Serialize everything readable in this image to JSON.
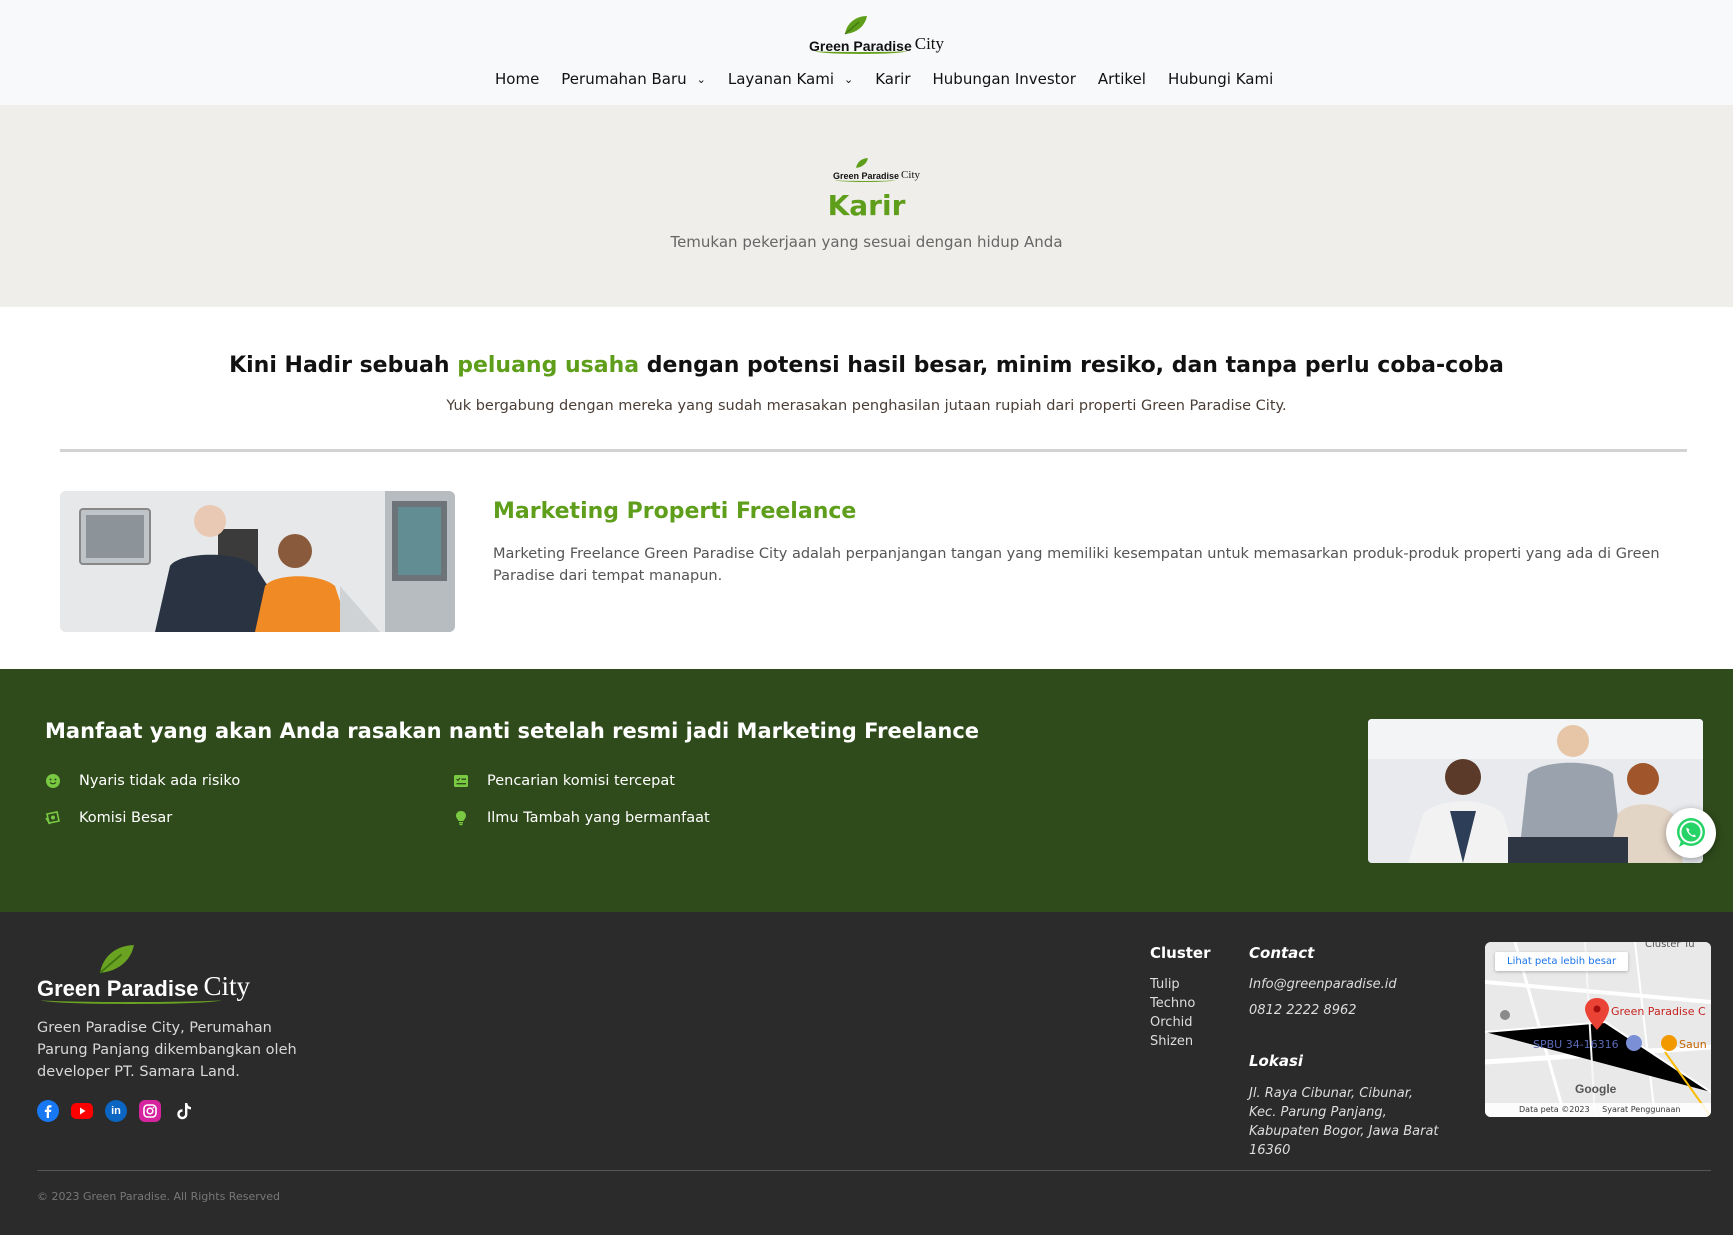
{
  "brand": {
    "name_word1": "Green Paradise",
    "name_word2": "City",
    "accent_color": "#5e9e1a",
    "dark_green": "#2f4a1b"
  },
  "nav": {
    "items": [
      {
        "label": "Home",
        "dropdown": false
      },
      {
        "label": "Perumahan Baru",
        "dropdown": true
      },
      {
        "label": "Layanan Kami",
        "dropdown": true
      },
      {
        "label": "Karir",
        "dropdown": false
      },
      {
        "label": "Hubungan Investor",
        "dropdown": false
      },
      {
        "label": "Artikel",
        "dropdown": false
      },
      {
        "label": "Hubungi Kami",
        "dropdown": false
      }
    ]
  },
  "page_header": {
    "title": "Karir",
    "subtitle": "Temukan pekerjaan yang sesuai dengan hidup Anda"
  },
  "intro": {
    "heading_before": "Kini Hadir sebuah",
    "heading_highlight": "peluang usaha",
    "heading_after": "dengan potensi hasil besar, minim resiko, dan tanpa perlu coba-coba",
    "text": "Yuk bergabung dengan mereka yang sudah merasakan penghasilan jutaan rupiah dari properti Green Paradise City."
  },
  "job": {
    "title": "Marketing Properti Freelance",
    "description": "Marketing Freelance Green Paradise City adalah perpanjangan tangan yang memiliki kesempatan untuk memasarkan produk-produk properti yang ada di Green Paradise dari tempat manapun."
  },
  "benefits": {
    "title": "Manfaat yang akan Anda rasakan nanti setelah resmi jadi Marketing Freelance",
    "items": [
      {
        "label": "Nyaris tidak ada risiko",
        "icon": "smile-icon"
      },
      {
        "label": "Pencarian komisi tercepat",
        "icon": "list-check-icon"
      },
      {
        "label": "Komisi Besar",
        "icon": "money-icon"
      },
      {
        "label": "Ilmu Tambah yang bermanfaat",
        "icon": "lightbulb-icon"
      }
    ]
  },
  "footer": {
    "description": "Green Paradise City, Perumahan Parung Panjang dikembangkan oleh developer PT. Samara Land.",
    "socials": [
      "facebook-icon",
      "youtube-icon",
      "linkedin-icon",
      "instagram-icon",
      "tiktok-icon"
    ],
    "cluster": {
      "title": "Cluster",
      "items": [
        "Tulip",
        "Techno",
        "Orchid",
        "Shizen"
      ]
    },
    "contact": {
      "title": "Contact",
      "email": "Info@greenparadise.id",
      "phone": "0812 2222 8962"
    },
    "location": {
      "title": "Lokasi",
      "address": "Jl. Raya Cibunar, Cibunar, Kec. Parung Panjang, Kabupaten Bogor, Jawa Barat 16360"
    },
    "map": {
      "link": "Lihat peta lebih besar",
      "place": "Green Paradise C",
      "spbu": "SPBU 34-16316",
      "saun": "Saun",
      "cluster_label": "Cluster Tu",
      "google": "Google",
      "data": "Data peta ©2023",
      "terms": "Syarat Penggunaan"
    },
    "copyright": "© 2023 Green Paradise. All Rights Reserved"
  }
}
